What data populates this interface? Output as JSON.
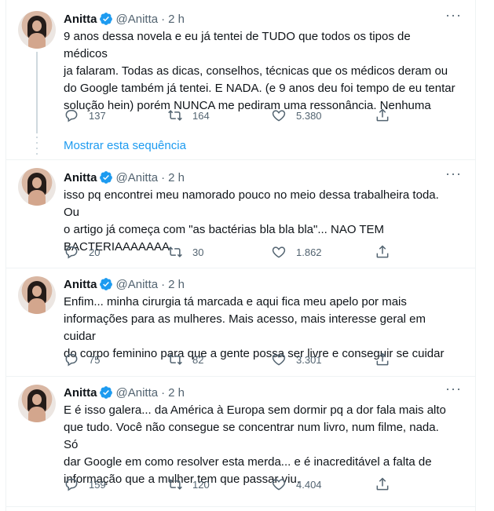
{
  "tweets": [
    {
      "name": "Anitta",
      "handle": "@Anitta",
      "time": "2 h",
      "text": "9 anos dessa novela e eu já tentei de TUDO que todos os tipos de médicos\nja falaram. Todas as dicas, conselhos, técnicas que os médicos deram ou\ndo Google também já tentei. E NADA. (e 9 anos deu foi tempo de eu tentar\nsolução hein) porém NUNCA me pediram uma ressonância. Nenhuma",
      "replies": "137",
      "retweets": "164",
      "likes": "5.380"
    },
    {
      "name": "Anitta",
      "handle": "@Anitta",
      "time": "2 h",
      "text": "isso pq encontrei meu namorado pouco no meio dessa trabalheira toda. Ou\no artigo já começa com \"as bactérias bla bla bla\"... NAO TEM\nBACTERIAAAAAAA",
      "replies": "20",
      "retweets": "30",
      "likes": "1.862"
    },
    {
      "name": "Anitta",
      "handle": "@Anitta",
      "time": "2 h",
      "text": "Enfim... minha cirurgia tá marcada e aqui fica meu apelo por mais\ninformações para as mulheres. Mais acesso, mais interesse geral em cuidar\ndo corpo feminino para que a gente possa ser livre e conseguir se cuidar",
      "replies": "75",
      "retweets": "82",
      "likes": "3.301"
    },
    {
      "name": "Anitta",
      "handle": "@Anitta",
      "time": "2 h",
      "text": "E é isso galera... da América à Europa sem dormir pq a dor fala mais alto\nque tudo. Você não consegue se concentrar num livro, num filme, nada. Só\ndar Google em como resolver esta merda... e é inacreditável a falta de\ninformação que a mulher tem que passar viu.",
      "replies": "159",
      "retweets": "120",
      "likes": "4.404"
    }
  ],
  "show_thread_label": "Mostrar esta sequência",
  "colors": {
    "accent": "#1d9bf0",
    "secondary_text": "#536471",
    "divider": "#eff3f4"
  }
}
